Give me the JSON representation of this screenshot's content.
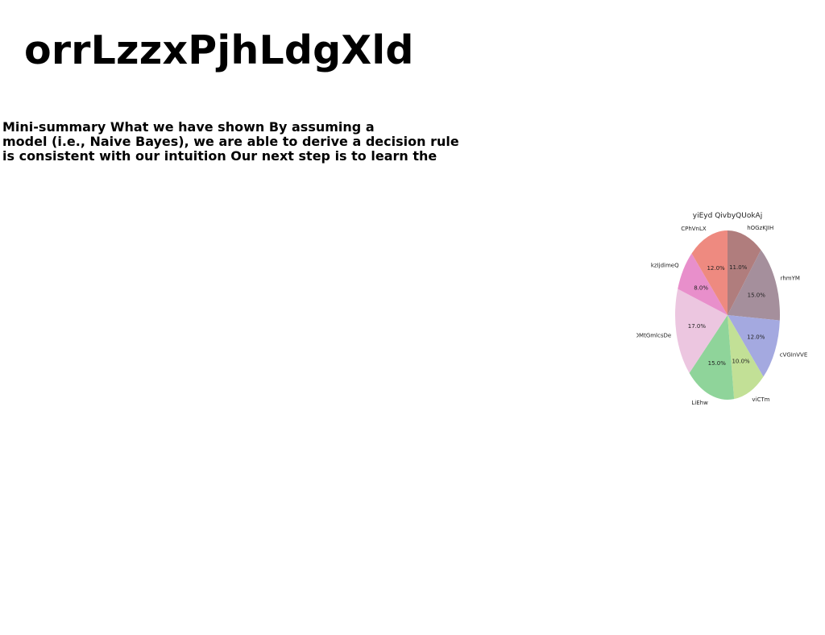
{
  "document": {
    "title": "orrLzzxPjhLdgXld",
    "summary_lines": [
      "Mini-summary What we have shown By assuming a",
      "model (i.e., Naive Bayes), we are able to derive a decision rule",
      "is consistent with our intuition Our next step is to learn the"
    ]
  },
  "chart_data": {
    "type": "pie",
    "title": "yiEyd QivbyQUokAj",
    "start_angle": 90,
    "direction": "clockwise",
    "slices": [
      {
        "label": "hOGzKJIH",
        "value": 11.0,
        "pct_text": "11.0%",
        "color": "#b07d7d"
      },
      {
        "label": "rhmYM",
        "value": 15.0,
        "pct_text": "15.0%",
        "color": "#a58f9c"
      },
      {
        "label": "cVGInVVE",
        "value": 12.0,
        "pct_text": "12.0%",
        "color": "#a4a9e0"
      },
      {
        "label": "viCTm",
        "value": 10.0,
        "pct_text": "10.0%",
        "color": "#c2e096"
      },
      {
        "label": "LiEhw",
        "value": 15.0,
        "pct_text": "15.0%",
        "color": "#8fd49a"
      },
      {
        "label": "DMtGmlcsDe",
        "value": 17.0,
        "pct_text": "17.0%",
        "color": "#ecc6e0"
      },
      {
        "label": "kzIjdimeQ",
        "value": 8.0,
        "pct_text": "8.0%",
        "color": "#e88fcb"
      },
      {
        "label": "CPhVnLX",
        "value": 12.0,
        "pct_text": "12.0%",
        "color": "#ee8a80"
      }
    ]
  }
}
